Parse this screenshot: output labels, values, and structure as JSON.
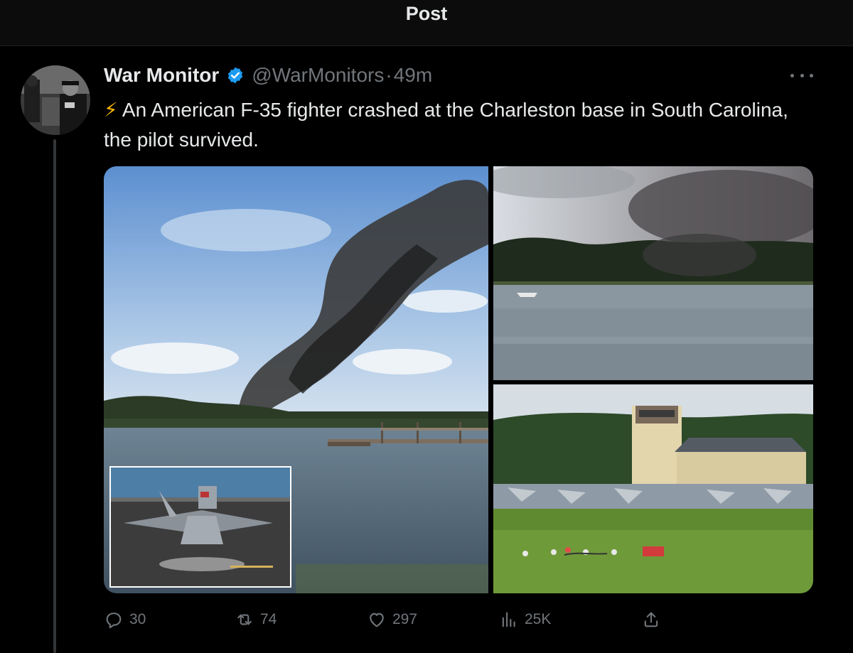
{
  "header": {
    "title": "Post"
  },
  "post": {
    "author_name": "War Monitor",
    "handle": "@WarMonitors",
    "separator": "·",
    "time": "49m",
    "emoji": "⚡",
    "text": "An American F-35 fighter crashed at the Charleston base in South Carolina, the pilot survived."
  },
  "actions": {
    "replies": "30",
    "reposts": "74",
    "likes": "297",
    "views": "25K"
  },
  "colors": {
    "background": "#000000",
    "text": "#e7e9ea",
    "muted": "#71767b",
    "verified": "#1d9bf0",
    "lightning": "#f4b400"
  },
  "icons": [
    "verified-badge-icon",
    "more-icon",
    "reply-icon",
    "repost-icon",
    "like-icon",
    "views-icon",
    "share-icon",
    "lightning-icon"
  ]
}
